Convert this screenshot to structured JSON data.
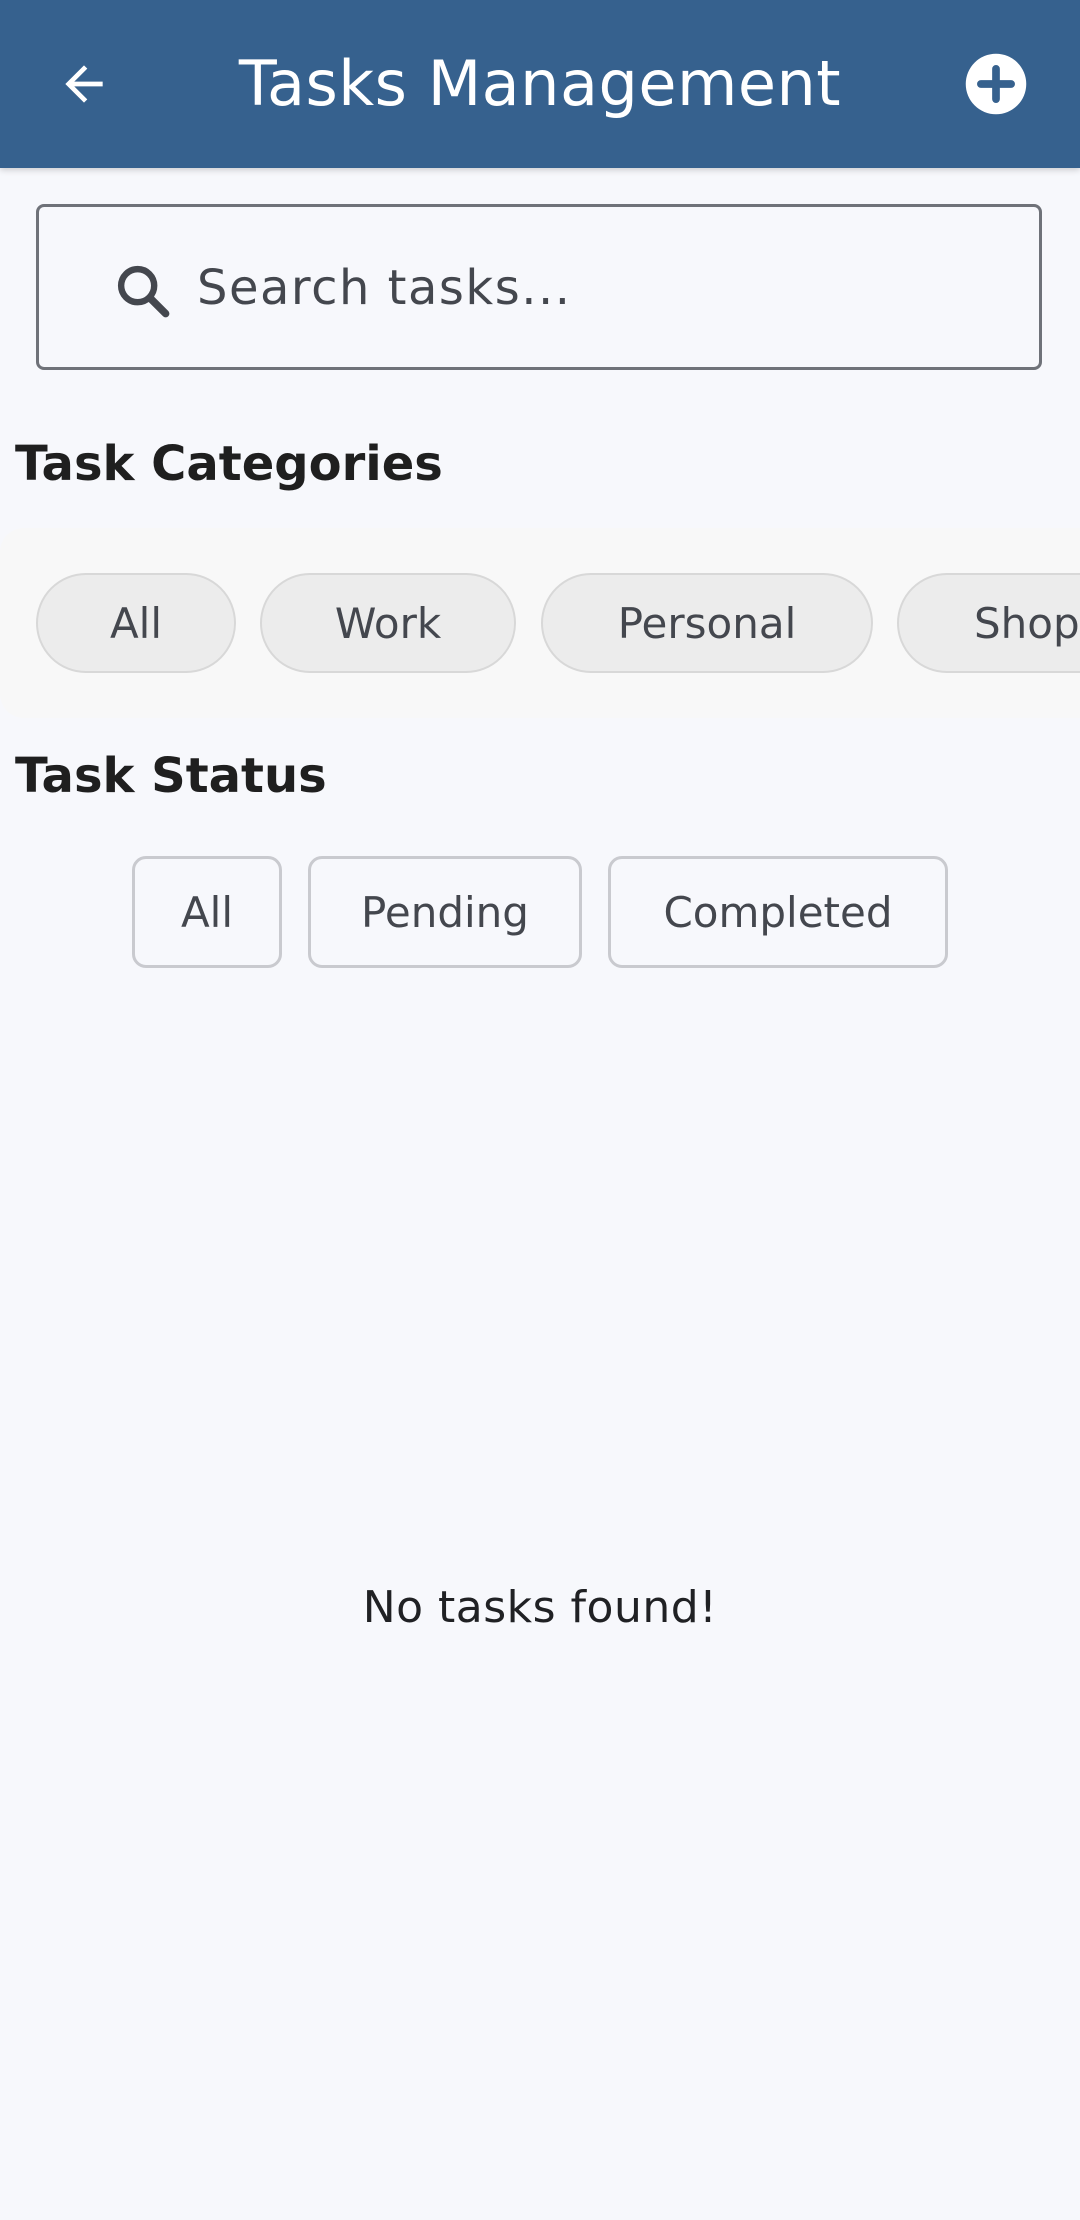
{
  "appbar": {
    "title": "Tasks Management",
    "back_icon": "arrow-back-icon",
    "add_icon": "add-circle-icon",
    "background": "#36618e"
  },
  "search": {
    "placeholder": "Search tasks...",
    "value": "",
    "icon": "search-icon"
  },
  "categories": {
    "heading": "Task Categories",
    "items": [
      {
        "label": "All"
      },
      {
        "label": "Work"
      },
      {
        "label": "Personal"
      },
      {
        "label": "Shop"
      }
    ]
  },
  "status": {
    "heading": "Task Status",
    "items": [
      {
        "label": "All"
      },
      {
        "label": "Pending"
      },
      {
        "label": "Completed"
      }
    ]
  },
  "empty_state": {
    "message": "No tasks found!"
  }
}
